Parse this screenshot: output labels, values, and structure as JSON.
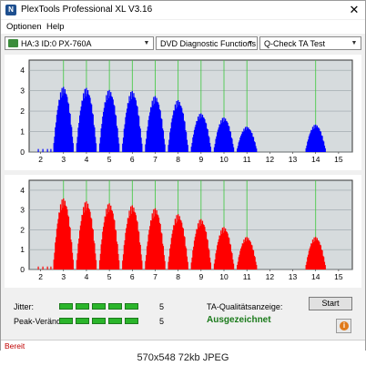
{
  "window": {
    "title": "PlexTools Professional XL V3.16",
    "close_glyph": "✕",
    "app_icon_text": "N"
  },
  "menu": {
    "items": [
      "Optionen",
      "Help"
    ]
  },
  "toolbar": {
    "drive": "HA:3 ID:0  PX-760A",
    "function": "DVD Diagnostic Functions",
    "test": "Q-Check  TA Test",
    "arrow_glyph": "▼"
  },
  "chart_data": [
    {
      "type": "bar",
      "panel": "top",
      "color": "#0000ff",
      "ylim": [
        0,
        4.5
      ],
      "yticks": [
        "0",
        "1",
        "2",
        "3",
        "4"
      ],
      "xlim": [
        1.5,
        15.6
      ],
      "xticks": [
        "2",
        "3",
        "4",
        "5",
        "6",
        "7",
        "8",
        "9",
        "10",
        "11",
        "12",
        "13",
        "14",
        "15"
      ],
      "grid_lines_at": [
        3,
        4,
        5,
        6,
        7,
        8,
        9,
        10,
        11,
        14
      ],
      "peaks": [
        {
          "center": 3.0,
          "height": 3.2
        },
        {
          "center": 4.0,
          "height": 3.15
        },
        {
          "center": 5.0,
          "height": 3.05
        },
        {
          "center": 6.0,
          "height": 3.0
        },
        {
          "center": 7.0,
          "height": 2.75
        },
        {
          "center": 8.0,
          "height": 2.55
        },
        {
          "center": 9.0,
          "height": 1.9
        },
        {
          "center": 10.0,
          "height": 1.7
        },
        {
          "center": 11.0,
          "height": 1.25
        },
        {
          "center": 14.0,
          "height": 1.35
        }
      ]
    },
    {
      "type": "bar",
      "panel": "bottom",
      "color": "#ff0000",
      "ylim": [
        0,
        4.5
      ],
      "yticks": [
        "0",
        "1",
        "2",
        "3",
        "4"
      ],
      "xlim": [
        1.5,
        15.6
      ],
      "xticks": [
        "2",
        "3",
        "4",
        "5",
        "6",
        "7",
        "8",
        "9",
        "10",
        "11",
        "12",
        "13",
        "14",
        "15"
      ],
      "grid_lines_at": [
        3,
        4,
        5,
        6,
        7,
        8,
        9,
        10,
        11,
        14
      ],
      "peaks": [
        {
          "center": 3.0,
          "height": 3.6
        },
        {
          "center": 4.0,
          "height": 3.45
        },
        {
          "center": 5.0,
          "height": 3.35
        },
        {
          "center": 6.0,
          "height": 3.25
        },
        {
          "center": 7.0,
          "height": 3.1
        },
        {
          "center": 8.0,
          "height": 2.8
        },
        {
          "center": 9.0,
          "height": 2.55
        },
        {
          "center": 10.0,
          "height": 2.15
        },
        {
          "center": 11.0,
          "height": 1.65
        },
        {
          "center": 14.0,
          "height": 1.65
        }
      ]
    }
  ],
  "results": {
    "jitter_label": "Jitter:",
    "jitter_value": "5",
    "jitter_level": 5,
    "peak_label": "Peak-Veränd:",
    "peak_value": "5",
    "peak_level": 5,
    "quality_label": "TA-Qualitätsanzeige:",
    "quality_value": "Ausgezeichnet",
    "quality_color": "#1a7a1a",
    "led_color": "#2bb52b"
  },
  "buttons": {
    "start": "Start",
    "info_glyph": "i"
  },
  "status": {
    "text": "Bereit"
  },
  "caption": "570x548  72kb  JPEG"
}
